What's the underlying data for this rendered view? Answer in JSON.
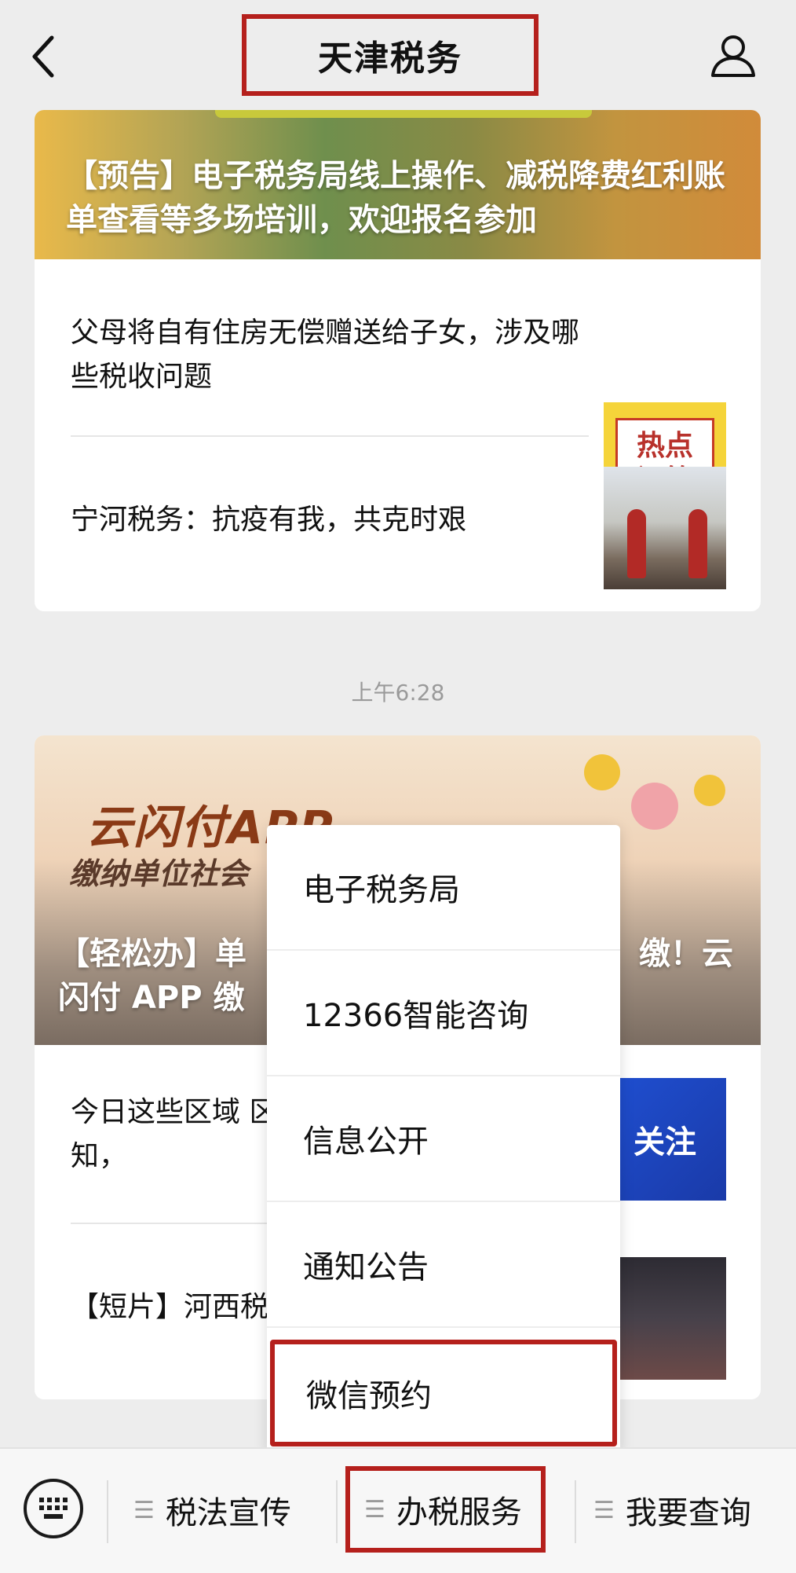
{
  "header": {
    "title": "天津税务",
    "back_icon": "back-arrow-icon",
    "profile_icon": "person-icon"
  },
  "card1": {
    "banner_text": "【预告】电子税务局线上操作、减税降费红利账单查看等多场培训，欢迎报名参加",
    "items": [
      {
        "text": "父母将自有住房无偿赠送给子女，涉及哪些税收问题",
        "thumb_line1": "热点",
        "thumb_line2": "问答"
      },
      {
        "text": "宁河税务：抗疫有我，共克时艰"
      }
    ]
  },
  "time": "上午6:28",
  "card2": {
    "banner_logo": "云闪付APP",
    "banner_sub": "缴纳单位社会",
    "banner_text_left": "【轻松办】单",
    "banner_text_right": "缴！云",
    "banner_text_line2": "闪付 APP 缴",
    "items": [
      {
        "text": "今日这些区域 区最新通知，",
        "thumb": "关注"
      },
      {
        "text": "【短片】河西税"
      }
    ]
  },
  "popup": {
    "items": [
      "电子税务局",
      "12366智能咨询",
      "信息公开",
      "通知公告",
      "微信预约"
    ]
  },
  "bottom": {
    "keyboard_icon": "keyboard-icon",
    "menus": [
      "税法宣传",
      "办税服务",
      "我要查询"
    ]
  }
}
